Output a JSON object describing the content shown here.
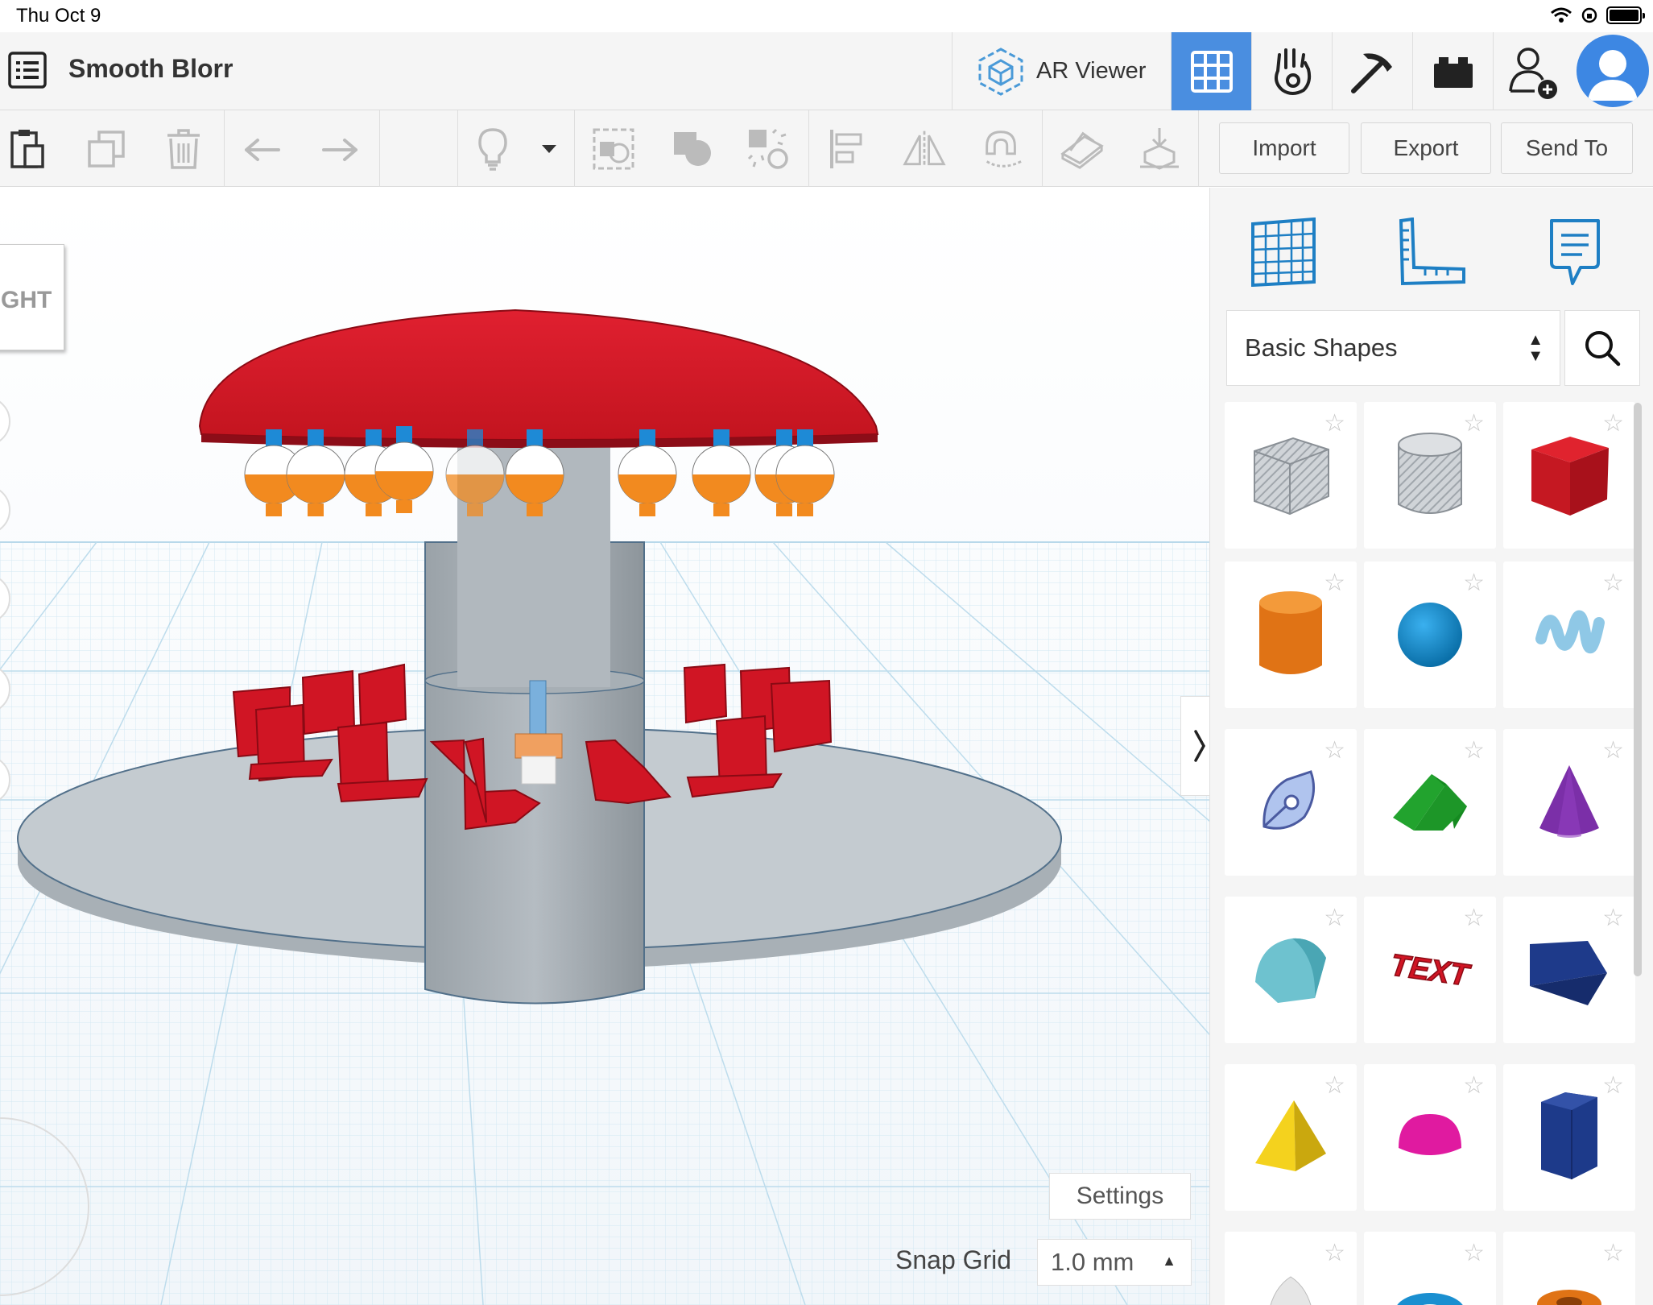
{
  "status_bar": {
    "time": "Thu Oct 9"
  },
  "header": {
    "title": "Smooth Blorr",
    "ar_viewer_label": "AR Viewer",
    "accent_color": "#4a8ee0"
  },
  "toolbar": {
    "import_label": "Import",
    "export_label": "Export",
    "send_to_label": "Send To"
  },
  "workplane": {
    "viewcube_label": "GHT",
    "settings_label": "Settings",
    "snap_grid_label": "Snap Grid",
    "snap_grid_value": "1.0 mm"
  },
  "panel": {
    "library_selected": "Basic Shapes",
    "shapes": [
      {
        "name": "box-hole-shape"
      },
      {
        "name": "cylinder-hole-shape"
      },
      {
        "name": "box-shape"
      },
      {
        "name": "cylinder-shape"
      },
      {
        "name": "sphere-shape"
      },
      {
        "name": "scribble-shape"
      },
      {
        "name": "shape-generator-shape"
      },
      {
        "name": "roof-shape"
      },
      {
        "name": "cone-shape"
      },
      {
        "name": "round-roof-shape"
      },
      {
        "name": "text-shape",
        "text": "TEXT"
      },
      {
        "name": "wedge-shape"
      },
      {
        "name": "pyramid-shape"
      },
      {
        "name": "half-sphere-shape"
      },
      {
        "name": "polygon-shape"
      },
      {
        "name": "paraboloid-shape"
      },
      {
        "name": "torus-shape"
      },
      {
        "name": "tube-shape"
      }
    ]
  }
}
